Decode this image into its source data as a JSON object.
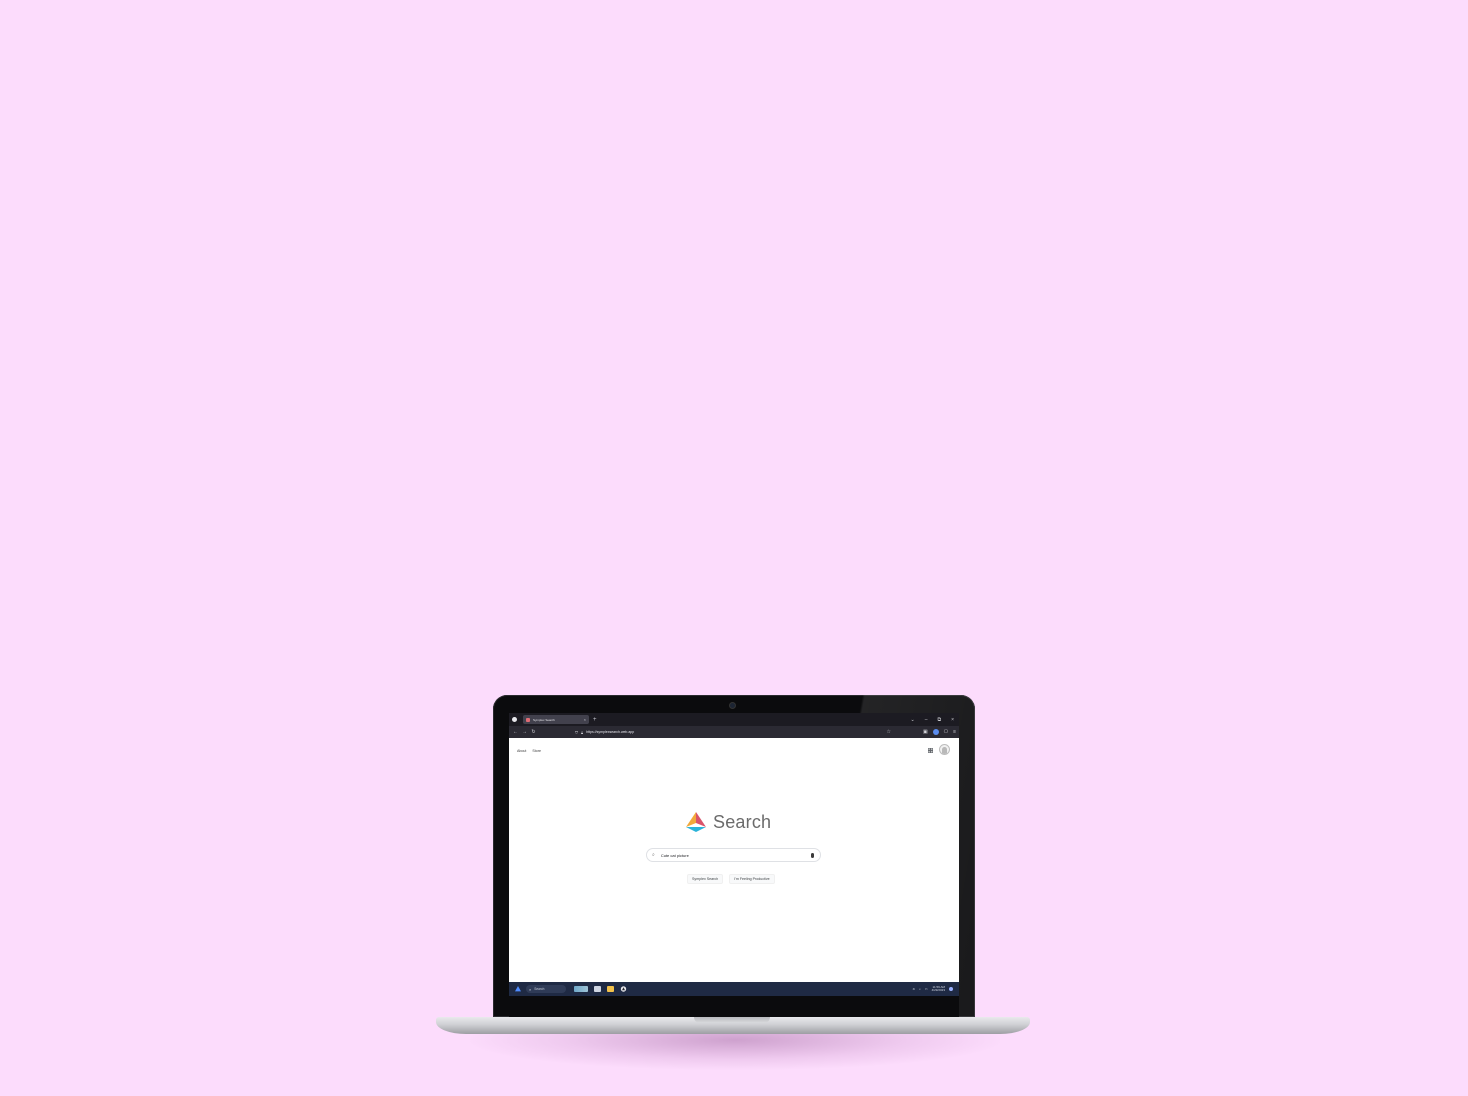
{
  "browser": {
    "tab_title": "Symplex Search",
    "tab_close": "×",
    "new_tab": "+",
    "window_controls": [
      "⌄",
      "–",
      "⧉",
      "×"
    ],
    "url": "https://symplexsearch.web.app",
    "nav_back": "←",
    "nav_forward": "→",
    "nav_reload": "↻"
  },
  "page": {
    "top_links": [
      "About",
      "Store"
    ],
    "logo_text": "Search",
    "search_value": "Cute cat picture",
    "buttons": [
      "Symplex Search",
      "I'm Feeling Productive"
    ]
  },
  "taskbar": {
    "search_placeholder": "Search",
    "time": "11:59 AM",
    "date": "4/29/2023"
  },
  "colors": {
    "background": "#fcdcfc",
    "logo_orange": "#f2a93b",
    "logo_red": "#d9546b",
    "logo_blue": "#2bb3d9"
  }
}
